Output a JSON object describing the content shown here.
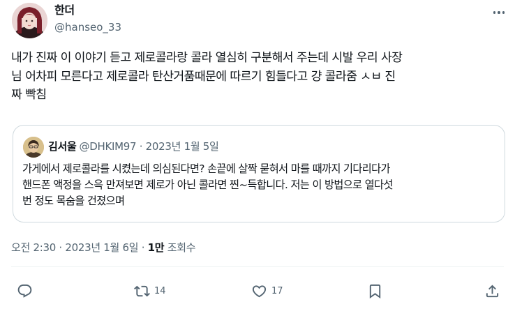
{
  "author": {
    "display_name": "한더",
    "handle": "@hanseo_33"
  },
  "tweet": {
    "text": "내가 진짜 이 이야기 듣고 제로콜라랑 콜라 열심히 구분해서 주는데 시발 우리 사장\n님 어차피 모른다고 제로콜라 탄산거품때문에 따르기 힘들다고 걍 콜라줌 ㅅㅂ 진\n짜 빡침"
  },
  "quote": {
    "display_name": "김서울",
    "meta": "@DHKIM97 · 2023년 1월 5일",
    "text": "가게에서 제로콜라를 시켰는데 의심된다면? 손끝에 살짝 묻혀서 마를 때까지 기다리다가\n핸드폰 액정을 스윽 만져보면 제로가 아닌 콜라면 찐~득합니다. 저는 이 방법으로 열다섯\n번 정도 목숨을 건졌으며"
  },
  "meta": {
    "timestamp": "오전 2:30 · 2023년 1월 6일 · ",
    "views_count": "1만",
    "views_label": " 조회수"
  },
  "actions": {
    "reply_icon": "reply-icon",
    "retweet_icon": "retweet-icon",
    "retweet_count": "14",
    "like_icon": "heart-icon",
    "like_count": "17",
    "bookmark_icon": "bookmark-icon",
    "share_icon": "share-icon"
  },
  "colors": {
    "text": "#0f1419",
    "secondary": "#536471",
    "border": "#cfd9de"
  }
}
